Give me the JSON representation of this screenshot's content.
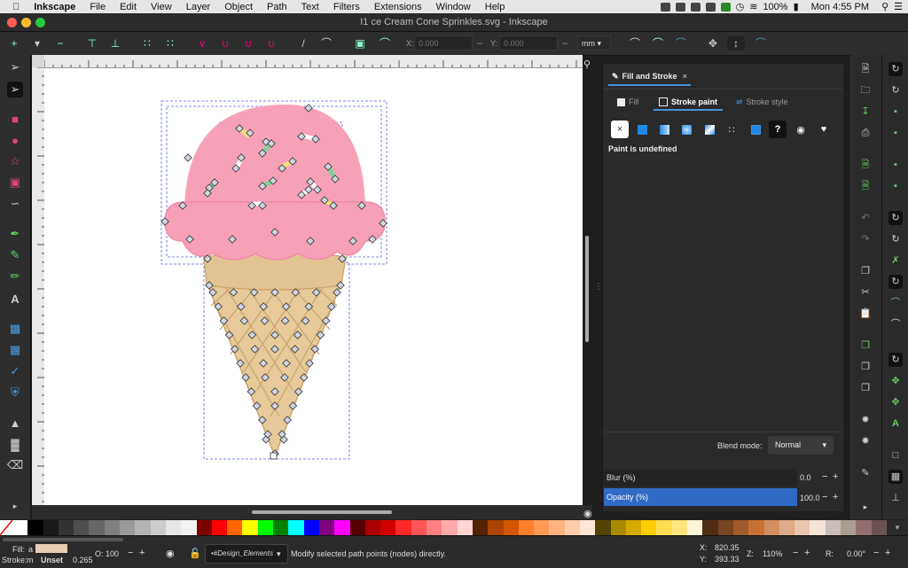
{
  "menubar": {
    "app_name": "Inkscape",
    "items": [
      "File",
      "Edit",
      "View",
      "Layer",
      "Object",
      "Path",
      "Text",
      "Filters",
      "Extensions",
      "Window",
      "Help"
    ],
    "battery": "100%",
    "clock": "Mon 4:55 PM"
  },
  "window": {
    "title": "I1 ce Cream Cone Sprinkles.svg - Inkscape"
  },
  "toolbar": {
    "x_label": "X:",
    "x_value": "0.000",
    "y_label": "Y:",
    "y_value": "0.000",
    "unit": "mm"
  },
  "dock": {
    "panel_title": "Fill and Stroke",
    "tabs": [
      "Fill",
      "Stroke paint",
      "Stroke style"
    ],
    "active_tab": "Stroke paint",
    "paint_status": "Paint is undefined",
    "blend_label": "Blend mode:",
    "blend_value": "Normal",
    "blur_label": "Blur (%)",
    "blur_value": "0.0",
    "opacity_label": "Opacity (%)",
    "opacity_value": "100.0"
  },
  "palette": [
    "#ffffff",
    "#000000",
    "#1a1a1a",
    "#333333",
    "#4d4d4d",
    "#666666",
    "#808080",
    "#999999",
    "#b3b3b3",
    "#cccccc",
    "#e6e6e6",
    "#f2f2f2",
    "#800000",
    "#ff0000",
    "#ff6600",
    "#ffff00",
    "#00ff00",
    "#008000",
    "#00ffff",
    "#0000ff",
    "#800080",
    "#ff00ff",
    "#550000",
    "#aa0000",
    "#d40000",
    "#ff2a2a",
    "#ff5555",
    "#ff8080",
    "#ffaaaa",
    "#ffd5d5",
    "#552200",
    "#aa4400",
    "#d45500",
    "#ff7f2a",
    "#ff9955",
    "#ffb380",
    "#ffccaa",
    "#ffe6d5",
    "#554400",
    "#aa8800",
    "#d4aa00",
    "#ffcc00",
    "#ffdd55",
    "#ffe680",
    "#fff6d5",
    "#502d16",
    "#784421",
    "#a05a2c",
    "#c87137",
    "#d38d5f",
    "#deaa87",
    "#e9c6af",
    "#f4e3d7",
    "#c8beb7",
    "#ac9d93",
    "#916f6f",
    "#6c5353"
  ],
  "status": {
    "fill_label": "Fill:",
    "fill_value": "a",
    "fill_color": "#e8cdb2",
    "stroke_label": "Stroke:",
    "stroke_value": "m",
    "stroke_state": "Unset",
    "stroke_width": "0.265",
    "opacity_label": "O:",
    "opacity_value": "100",
    "layer": "•#Design_Elements",
    "message": "Modify selected path points (nodes) directly.",
    "x_label": "X:",
    "x": "820.35",
    "y_label": "Y:",
    "y": "393.33",
    "zoom_label": "Z:",
    "zoom": "110%",
    "rotate_label": "R:",
    "rotate": "0.00°"
  },
  "colors": {
    "scoop": "#f7a1b8",
    "scoop_dark": "#f28aa7",
    "cone": "#e7c99a",
    "cone_dark": "#c9a36b",
    "accent": "#2f6bc4"
  }
}
